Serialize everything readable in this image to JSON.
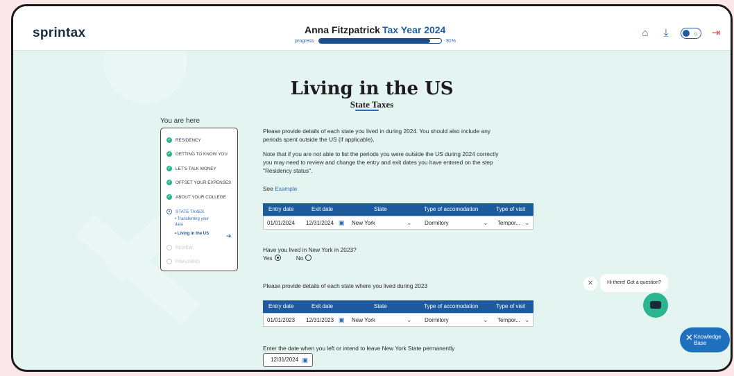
{
  "header": {
    "logo": "sprintax",
    "user_name": "Anna Fitzpatrick",
    "tax_year": "Tax Year 2024",
    "progress_label": "progress",
    "progress_value": 91,
    "progress_text": "91%"
  },
  "page": {
    "title": "Living in the US",
    "subtitle": "State Taxes"
  },
  "sidebar": {
    "heading": "You are here",
    "steps": [
      {
        "label": "Residency",
        "status": "done"
      },
      {
        "label": "Getting to know you",
        "status": "done"
      },
      {
        "label": "Let's talk money",
        "status": "done"
      },
      {
        "label": "Offset your expenses",
        "status": "done"
      },
      {
        "label": "About your college",
        "status": "done"
      },
      {
        "label": "State taxes",
        "status": "active"
      },
      {
        "label": "Review",
        "status": "pending"
      },
      {
        "label": "Finalising",
        "status": "pending"
      }
    ],
    "substeps": [
      "• Transferring your",
      "data",
      "• Living in the US"
    ]
  },
  "content": {
    "para1_line1": "Please provide details of each state you lived in during 2024. You should also include any",
    "para1_line2": "periods spent outside the US (if applicable).",
    "para2_line1": "Note that if you are not able to list the periods you were outside the US during 2024 correctly",
    "para2_line2": "you may need to review and change the entry and exit dates you have entered on the step",
    "para2_line3": "\"Residency status\".",
    "see": "See",
    "example_link": "Example",
    "question_2023": "Have you lived in New York in 2023?",
    "yes": "Yes",
    "no": "No",
    "para3": "Please provide details of each state where you lived during 2023",
    "leave_label": "Enter the date when you left or intend to leave New York State permanently",
    "leave_date": "12/31/2024"
  },
  "table_headers": [
    "Entry date",
    "Exit date",
    "State",
    "Type of accomodation",
    "Type of visit"
  ],
  "table1": {
    "entry": "01/01/2024",
    "exit": "12/31/2024",
    "state": "New York",
    "accom": "Dormitory",
    "visit": "Tempor..."
  },
  "table2": {
    "entry": "01/01/2023",
    "exit": "12/31/2023",
    "state": "New York",
    "accom": "Dormitory",
    "visit": "Tempor..."
  },
  "chat": {
    "bubble": "Hi there! Got a question?"
  },
  "kb": {
    "line1": "Knowledge",
    "line2": "Base"
  }
}
